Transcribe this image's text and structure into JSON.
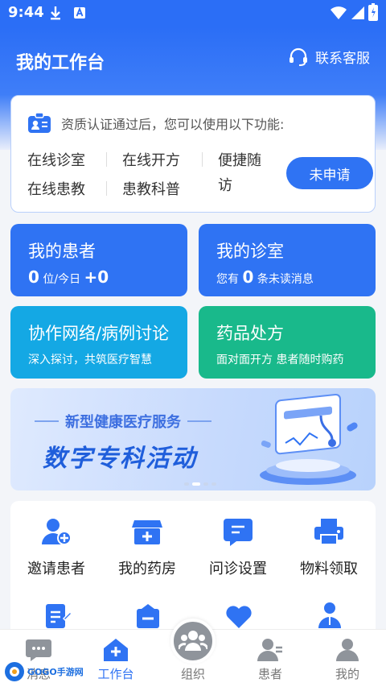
{
  "status_bar": {
    "time": "9:44"
  },
  "header": {
    "title": "我的工作台",
    "contact_label": "联系客服"
  },
  "qualification": {
    "notice": "资质认证通过后，您可以使用以下功能:",
    "features": [
      "在线诊室",
      "在线开方",
      "便捷随",
      "访",
      "在线患教",
      "患教科普"
    ],
    "apply_label": "未申请"
  },
  "tiles": {
    "patients": {
      "title": "我的患者",
      "count": "0",
      "unit": "位/今日",
      "today": "+0"
    },
    "clinic": {
      "title": "我的诊室",
      "prefix": "您有",
      "count": "0",
      "suffix": "条未读消息"
    },
    "collab": {
      "title": "协作网络/病例讨论",
      "sub": "深入探讨，共筑医疗智慧"
    },
    "rx": {
      "title": "药品处方",
      "sub": "面对面开方 患者随时购药"
    }
  },
  "banner": {
    "subtitle": "新型健康医疗服务",
    "title": "数字专科活动"
  },
  "menu": {
    "items": [
      "邀请患者",
      "我的药房",
      "问诊设置",
      "物料领取"
    ]
  },
  "tabbar": {
    "tabs": [
      "消息",
      "工作台",
      "组织",
      "患者",
      "我的"
    ]
  },
  "watermark": {
    "text": "GOGO手游网"
  },
  "colors": {
    "primary": "#2f73f3",
    "cyan": "#14a8e4",
    "green": "#19b98b"
  }
}
